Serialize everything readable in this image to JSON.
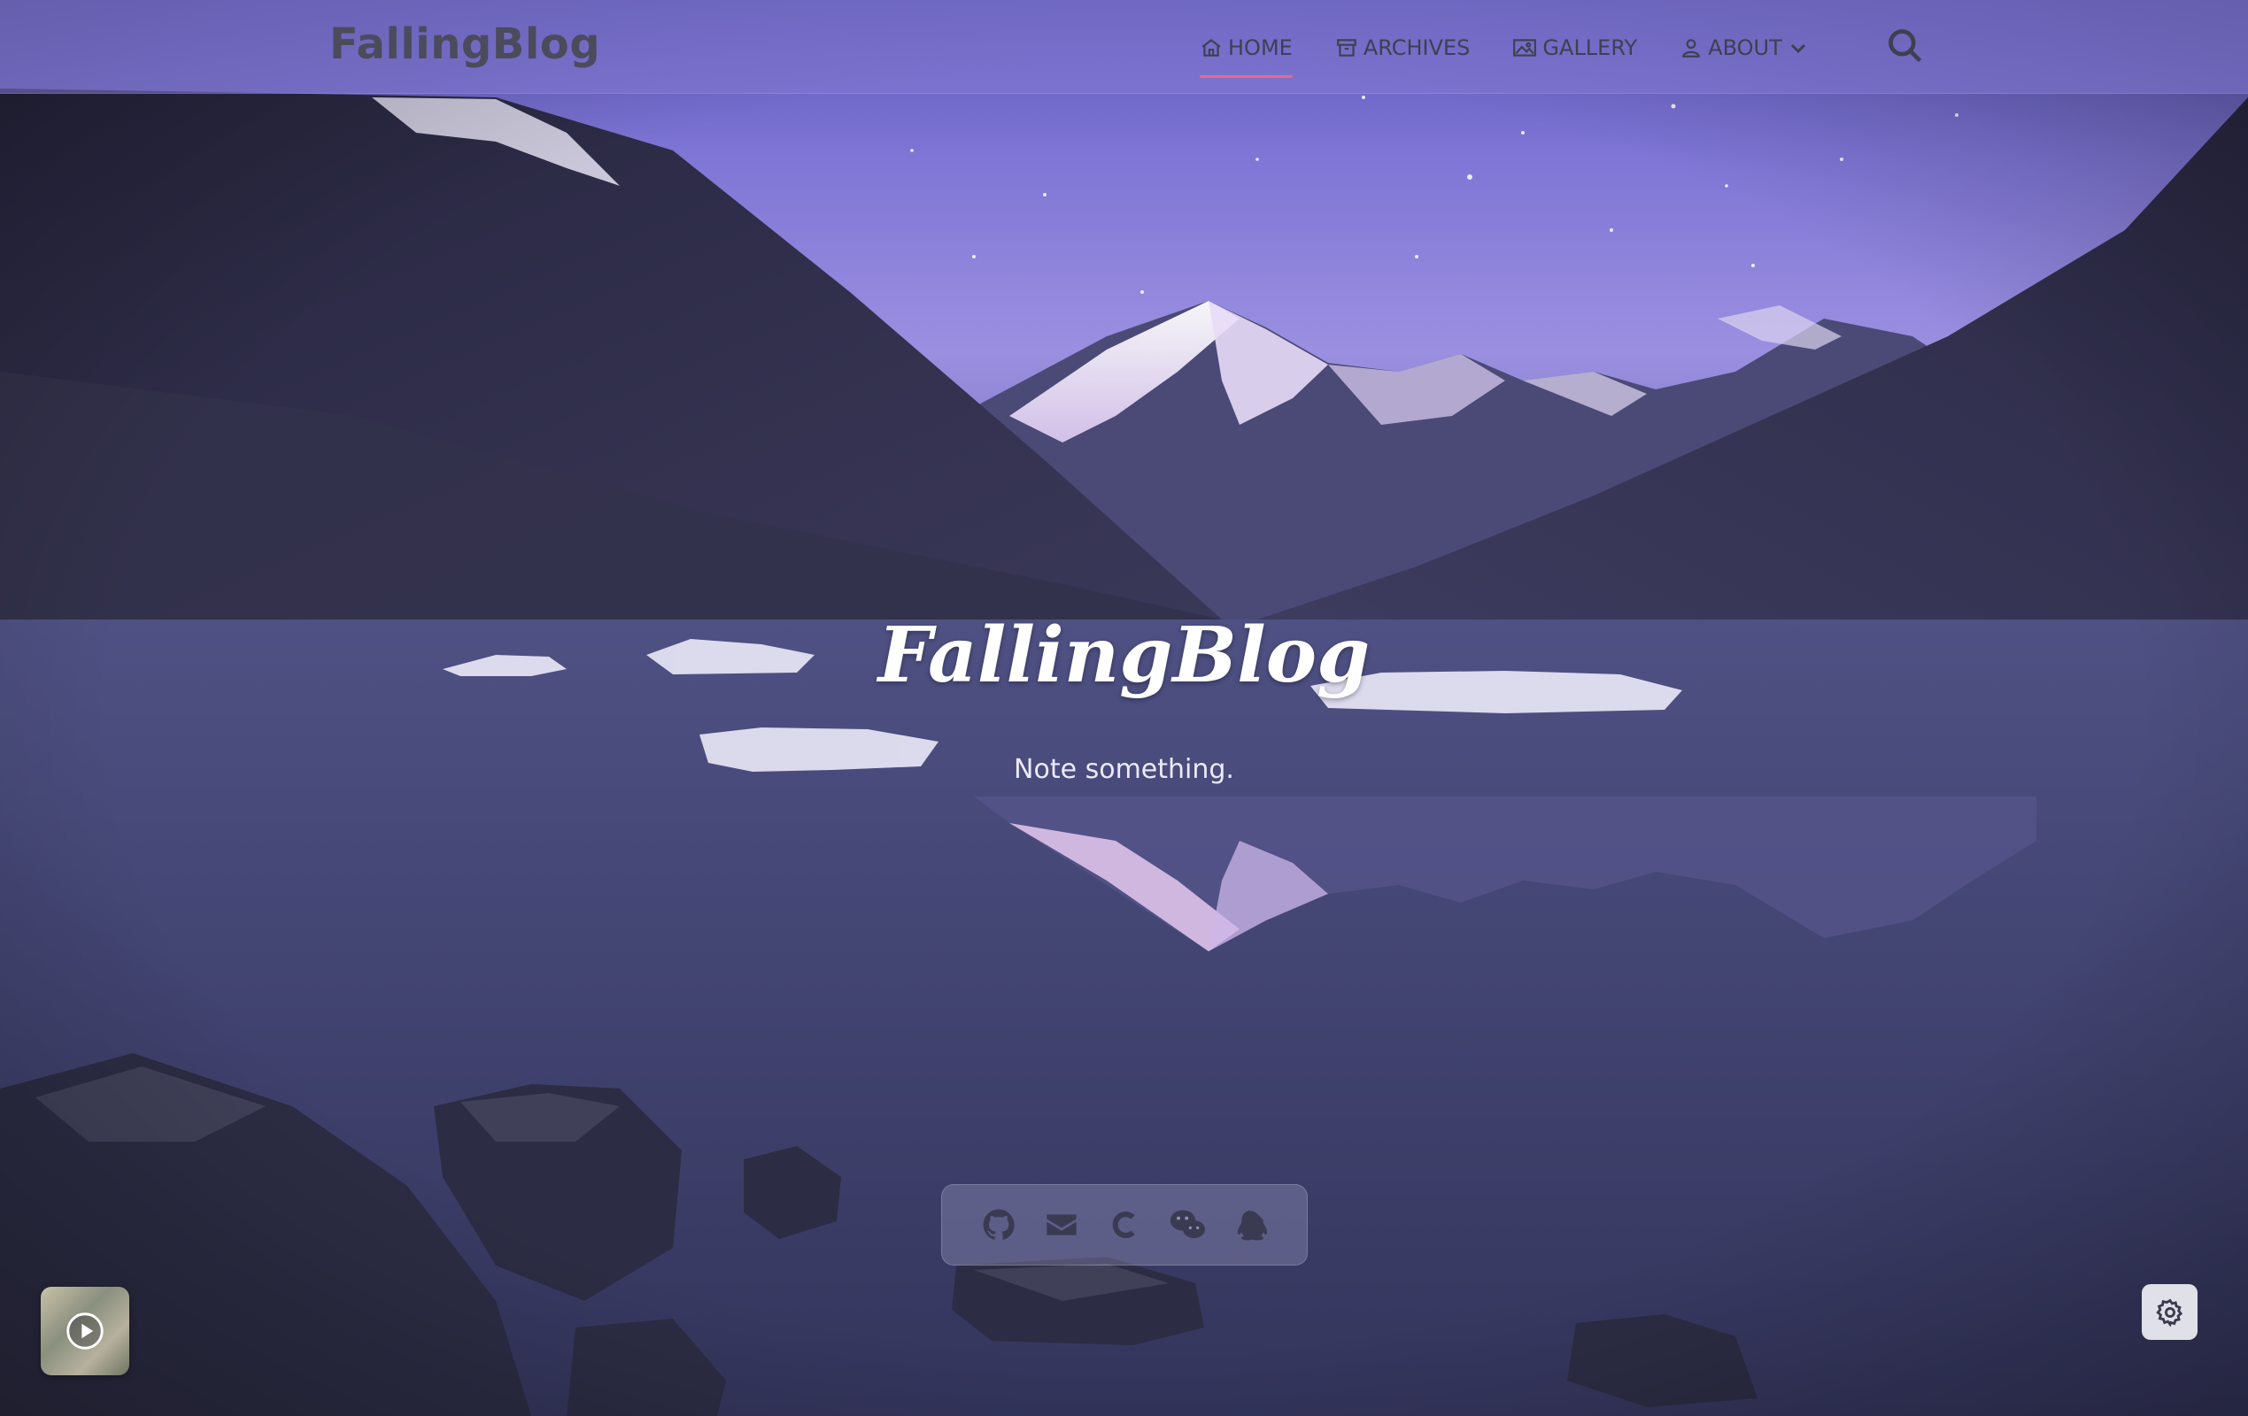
{
  "header": {
    "brand": "FallingBlog",
    "nav": [
      {
        "label": "HOME",
        "icon": "home-icon",
        "active": true
      },
      {
        "label": "ARCHIVES",
        "icon": "archive-icon"
      },
      {
        "label": "GALLERY",
        "icon": "gallery-icon"
      },
      {
        "label": "ABOUT",
        "icon": "user-icon",
        "dropdown": true
      }
    ],
    "search_icon": "search-icon"
  },
  "hero": {
    "title": "FallingBlog",
    "subtitle": "Note something."
  },
  "social": [
    {
      "icon": "github-icon"
    },
    {
      "icon": "email-icon"
    },
    {
      "icon": "csdn-icon"
    },
    {
      "icon": "wechat-icon"
    },
    {
      "icon": "qq-icon"
    }
  ],
  "widgets": {
    "music_player_icon": "play-icon",
    "settings_icon": "gear-icon"
  },
  "colors": {
    "nav_active_underline": "#e9688c",
    "navbar_bg": "#847ad4",
    "sky_top": "#6f67c9",
    "lake": "#3a3b6a"
  }
}
